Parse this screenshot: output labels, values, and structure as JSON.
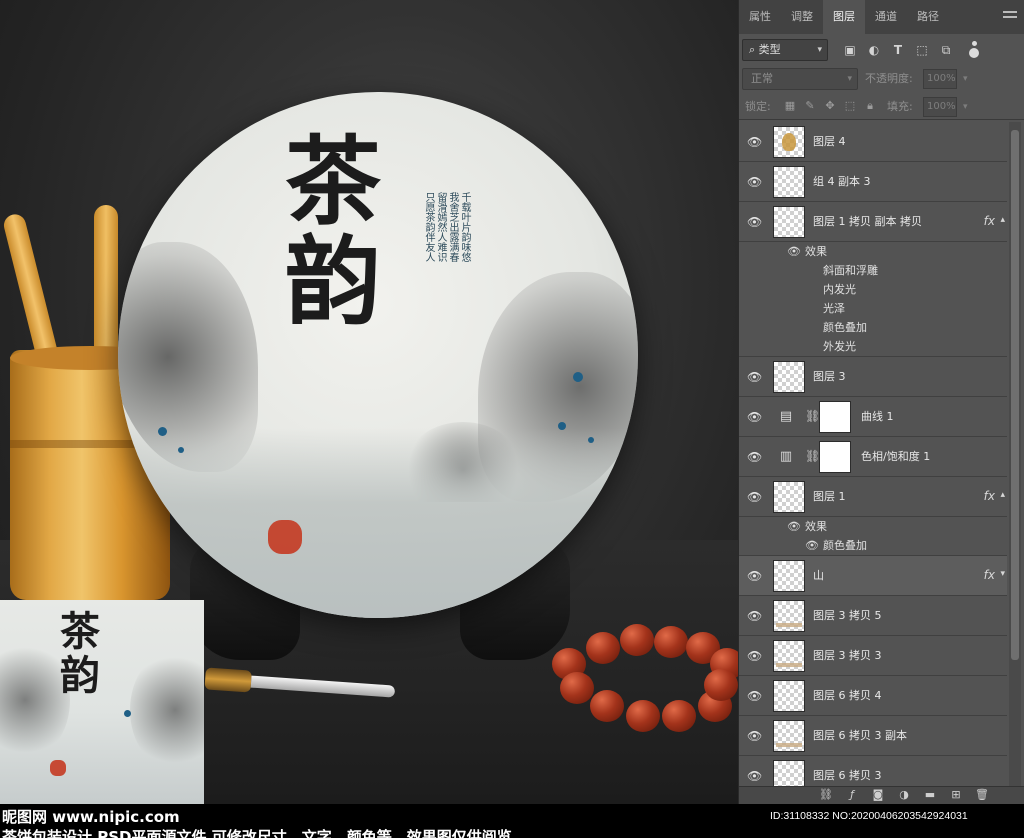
{
  "canvas": {
    "artwork_title": "茶韵",
    "vertical_text": [
      "千载叶片韵味悠",
      "我舍芝出露满春",
      "留滑嫣然人难识",
      "只愿茶韵伴友人"
    ],
    "thumbnail_title": "茶韵"
  },
  "watermark": {
    "site_cn": "昵图网",
    "site_url": "www.nipic.com",
    "id_text": "ID:31108332 NO:20200406203542924031",
    "description": "茶饼包装设计 PSD平面源文件 可修改尺寸、文字、颜色等，效果图仅供阅览"
  },
  "panel": {
    "tabs": [
      {
        "label": "属性",
        "active": false
      },
      {
        "label": "调整",
        "active": false
      },
      {
        "label": "图层",
        "active": true
      },
      {
        "label": "通道",
        "active": false
      },
      {
        "label": "路径",
        "active": false
      }
    ],
    "filter": {
      "label": "类型",
      "icon": "search-icon"
    },
    "blend_mode": "正常",
    "opacity_label": "不透明度:",
    "opacity_value": "100%",
    "lock_label": "锁定:",
    "fill_label": "填充:",
    "fill_value": "100%",
    "layers": [
      {
        "name": "图层 4",
        "thumb": "image",
        "fx": false
      },
      {
        "name": "组 4 副本 3",
        "thumb": "empty",
        "fx": false
      },
      {
        "name": "图层 1 拷贝 副本 拷贝",
        "thumb": "empty",
        "fx": true,
        "effects_label": "效果",
        "effects": [
          "斜面和浮雕",
          "内发光",
          "光泽",
          "颜色叠加",
          "外发光"
        ]
      },
      {
        "name": "图层 3",
        "thumb": "empty",
        "fx": false
      },
      {
        "name": "曲线 1",
        "thumb": "curves-icon",
        "fx": false,
        "mask": true
      },
      {
        "name": "色相/饱和度 1",
        "thumb": "hue-saturation-icon",
        "fx": false,
        "mask": true
      },
      {
        "name": "图层 1",
        "thumb": "empty",
        "fx": true,
        "effects_label": "效果",
        "effects": [
          "颜色叠加"
        ]
      },
      {
        "name": "山",
        "thumb": "empty",
        "fx": true,
        "selected": true
      },
      {
        "name": "图层 3 拷贝 5",
        "thumb": "strip",
        "fx": false
      },
      {
        "name": "图层 3 拷贝 3",
        "thumb": "strip",
        "fx": false
      },
      {
        "name": "图层 6 拷贝 4",
        "thumb": "empty",
        "fx": false
      },
      {
        "name": "图层 6 拷贝 3 副本",
        "thumb": "strip",
        "fx": false
      },
      {
        "name": "图层 6 拷贝 3",
        "thumb": "empty",
        "fx": false
      }
    ],
    "fx_label": "fx"
  }
}
